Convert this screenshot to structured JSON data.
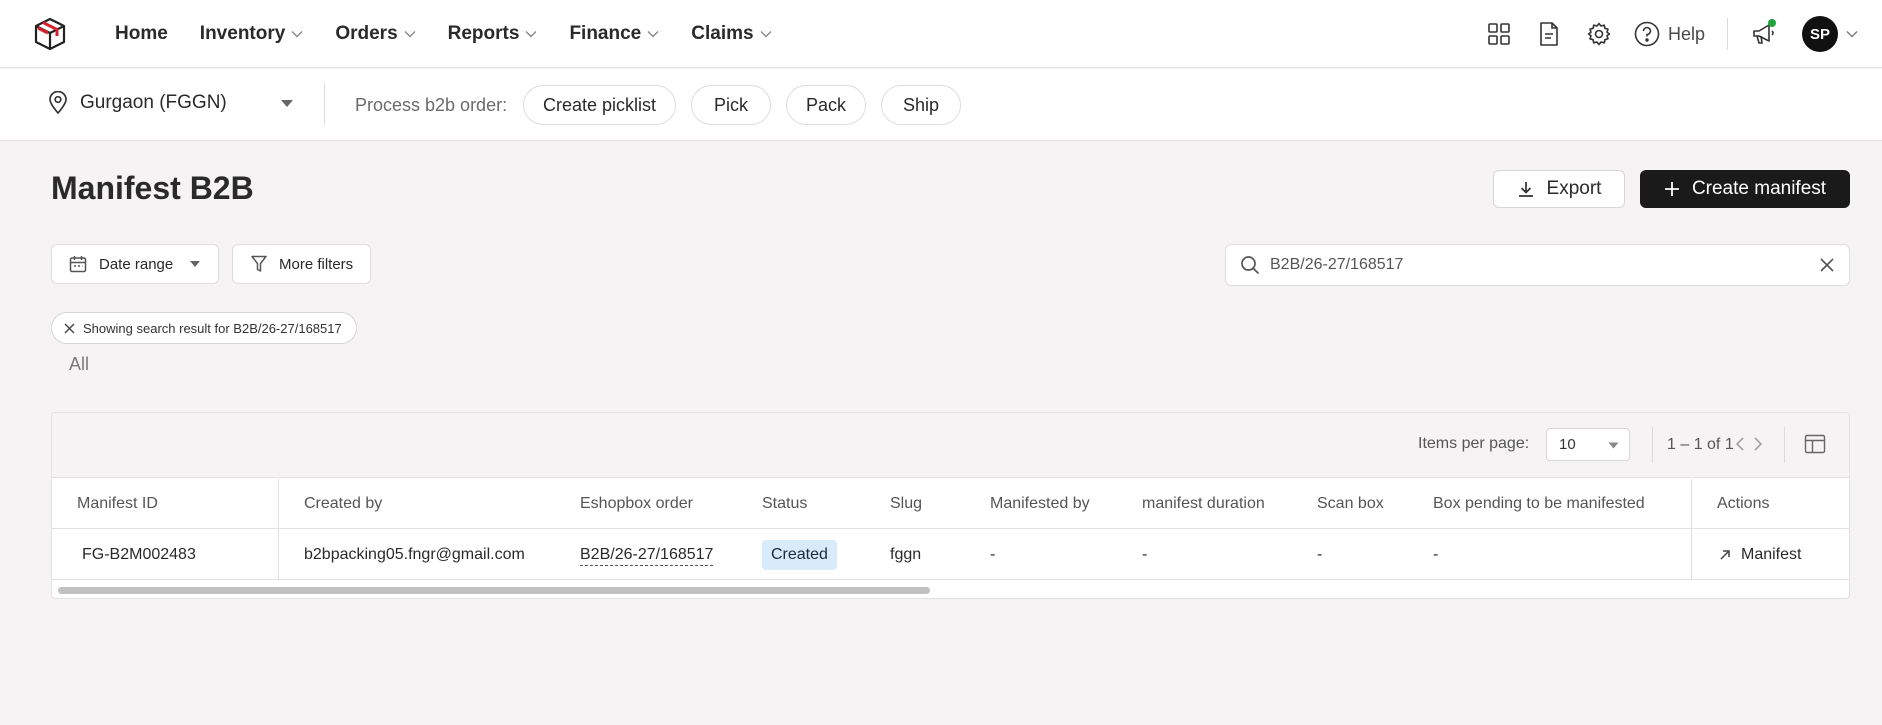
{
  "nav": {
    "items": [
      {
        "label": "Home",
        "has_menu": false
      },
      {
        "label": "Inventory",
        "has_menu": true
      },
      {
        "label": "Orders",
        "has_menu": true
      },
      {
        "label": "Reports",
        "has_menu": true
      },
      {
        "label": "Finance",
        "has_menu": true
      },
      {
        "label": "Claims",
        "has_menu": true
      }
    ],
    "help_label": "Help",
    "avatar_initials": "SP"
  },
  "subbar": {
    "location": "Gurgaon (FGGN)",
    "process_label": "Process b2b order:",
    "actions": [
      "Create picklist",
      "Pick",
      "Pack",
      "Ship"
    ]
  },
  "page": {
    "title": "Manifest B2B",
    "export_label": "Export",
    "create_label": "Create manifest"
  },
  "filters": {
    "date_range_label": "Date range",
    "more_filters_label": "More filters",
    "search_value": "B2B/26-27/168517",
    "chip_text": "Showing search result for B2B/26-27/168517",
    "tab_label": "All"
  },
  "table": {
    "items_per_page_label": "Items per page:",
    "items_per_page_value": "10",
    "range_text": "1 – 1 of 1",
    "columns": [
      "Manifest ID",
      "Created by",
      "Eshopbox order",
      "Status",
      "Slug",
      "Manifested by",
      "manifest duration",
      "Scan box",
      "Box pending to be manifested",
      "Actions"
    ],
    "rows": [
      {
        "manifest_id": "FG-B2M002483",
        "created_by": "b2bpacking05.fngr@gmail.com",
        "order": "B2B/26-27/168517",
        "status": "Created",
        "slug": "fggn",
        "manifested_by": "-",
        "duration": "-",
        "scan_box": "-",
        "box_pending": "-",
        "action_label": "Manifest"
      }
    ]
  },
  "colors": {
    "brand_red": "#d6202a",
    "status_badge_bg": "#d7ebfb",
    "primary_button": "#1a1a1a",
    "notification_dot": "#1fa33a"
  }
}
